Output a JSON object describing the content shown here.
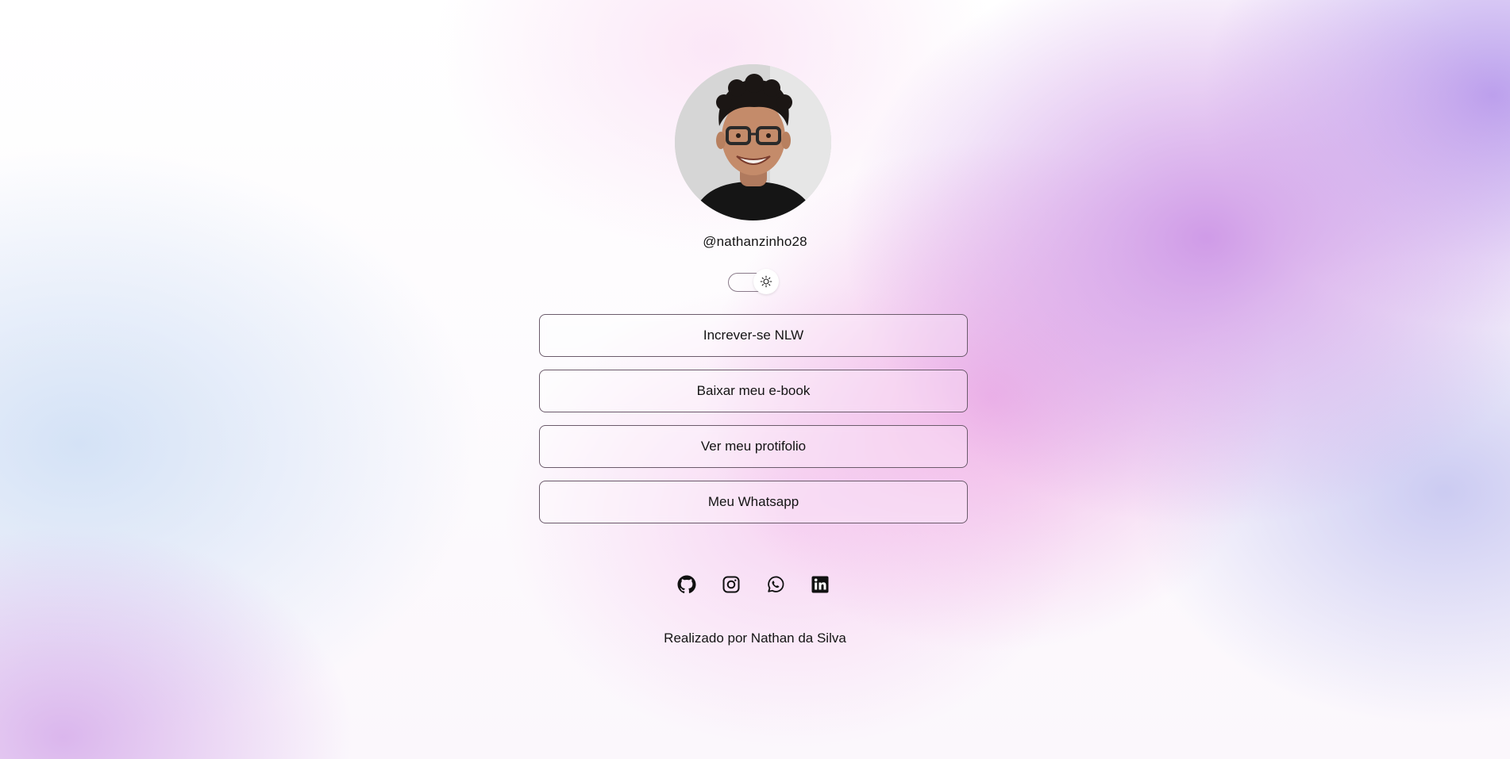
{
  "profile": {
    "username": "@nathanzinho28",
    "avatar_alt": "Nathan da Silva"
  },
  "theme_switch": {
    "icon": "sun-icon",
    "state": "light"
  },
  "links": [
    {
      "label": "Increver-se NLW"
    },
    {
      "label": "Baixar meu e-book"
    },
    {
      "label": "Ver meu protifolio"
    },
    {
      "label": "Meu Whatsapp"
    }
  ],
  "social_icons": [
    "github-icon",
    "instagram-icon",
    "whatsapp-icon",
    "linkedin-icon"
  ],
  "footer": {
    "text": "Realizado por Nathan da Silva"
  }
}
